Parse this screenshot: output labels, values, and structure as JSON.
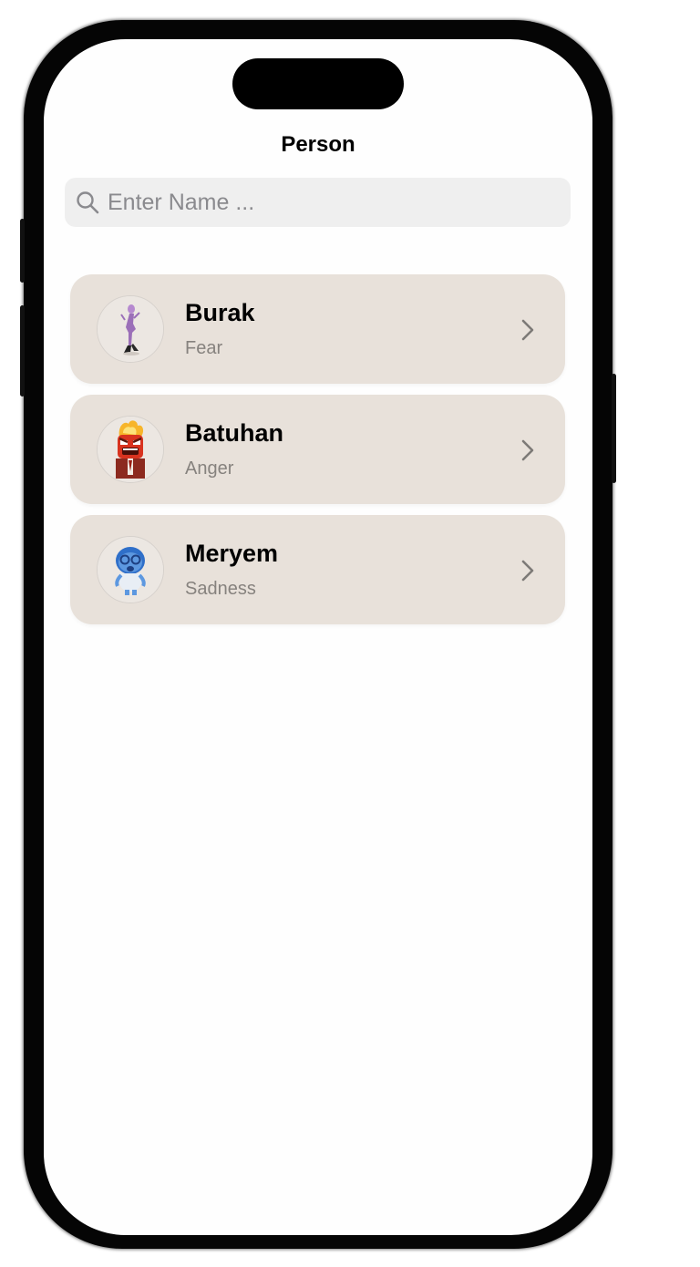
{
  "nav": {
    "title": "Person"
  },
  "search": {
    "placeholder": "Enter Name ...",
    "value": ""
  },
  "people": [
    {
      "name": "Burak",
      "emotion": "Fear",
      "avatar_icon": "fear-character-icon",
      "avatar_color": "#9b6fb8"
    },
    {
      "name": "Batuhan",
      "emotion": "Anger",
      "avatar_icon": "anger-character-icon",
      "avatar_color": "#d8331f"
    },
    {
      "name": "Meryem",
      "emotion": "Sadness",
      "avatar_icon": "sadness-character-icon",
      "avatar_color": "#2f6fc9"
    }
  ],
  "colors": {
    "card_background": "#e8e1da",
    "search_background": "#efefef",
    "secondary_text": "#86827e",
    "chevron": "#7d7a77"
  },
  "icons": {
    "search": "search-icon",
    "row_disclosure": "chevron-right-icon"
  }
}
